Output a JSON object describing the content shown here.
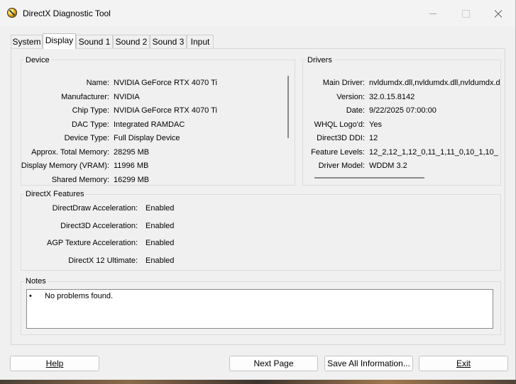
{
  "window": {
    "title": "DirectX Diagnostic Tool"
  },
  "tabs": [
    "System",
    "Display",
    "Sound 1",
    "Sound 2",
    "Sound 3",
    "Input"
  ],
  "active_tab": "Display",
  "device": {
    "title": "Device",
    "rows": [
      {
        "label": "Name:",
        "value": "NVIDIA GeForce RTX 4070 Ti"
      },
      {
        "label": "Manufacturer:",
        "value": "NVIDIA"
      },
      {
        "label": "Chip Type:",
        "value": "NVIDIA GeForce RTX 4070 Ti"
      },
      {
        "label": "DAC Type:",
        "value": "Integrated RAMDAC"
      },
      {
        "label": "Device Type:",
        "value": "Full Display Device"
      },
      {
        "label": "Approx. Total Memory:",
        "value": "28295 MB"
      },
      {
        "label": "Display Memory (VRAM):",
        "value": "11996 MB"
      },
      {
        "label": "Shared Memory:",
        "value": "16299 MB"
      }
    ]
  },
  "drivers": {
    "title": "Drivers",
    "rows": [
      {
        "label": "Main Driver:",
        "value": "nvldumdx.dll,nvldumdx.dll,nvldumdx.d"
      },
      {
        "label": "Version:",
        "value": "32.0.15.8142"
      },
      {
        "label": "Date:",
        "value": "9/22/2025 07:00:00"
      },
      {
        "label": "WHQL Logo'd:",
        "value": "Yes"
      },
      {
        "label": "Direct3D DDI:",
        "value": "12"
      },
      {
        "label": "Feature Levels:",
        "value": "12_2,12_1,12_0,11_1,11_0,10_1,10_"
      },
      {
        "label": "Driver Model:",
        "value": "WDDM 3.2"
      }
    ]
  },
  "features": {
    "title": "DirectX Features",
    "rows": [
      {
        "label": "DirectDraw Acceleration:",
        "value": "Enabled"
      },
      {
        "label": "Direct3D Acceleration:",
        "value": "Enabled"
      },
      {
        "label": "AGP Texture Acceleration:",
        "value": "Enabled"
      },
      {
        "label": "DirectX 12 Ultimate:",
        "value": "Enabled"
      }
    ]
  },
  "notes": {
    "title": "Notes",
    "bullet": "•",
    "items": [
      "No problems found."
    ]
  },
  "buttons": {
    "help": "Help",
    "next_page": "Next Page",
    "save_all": "Save All Information...",
    "exit": "Exit"
  }
}
